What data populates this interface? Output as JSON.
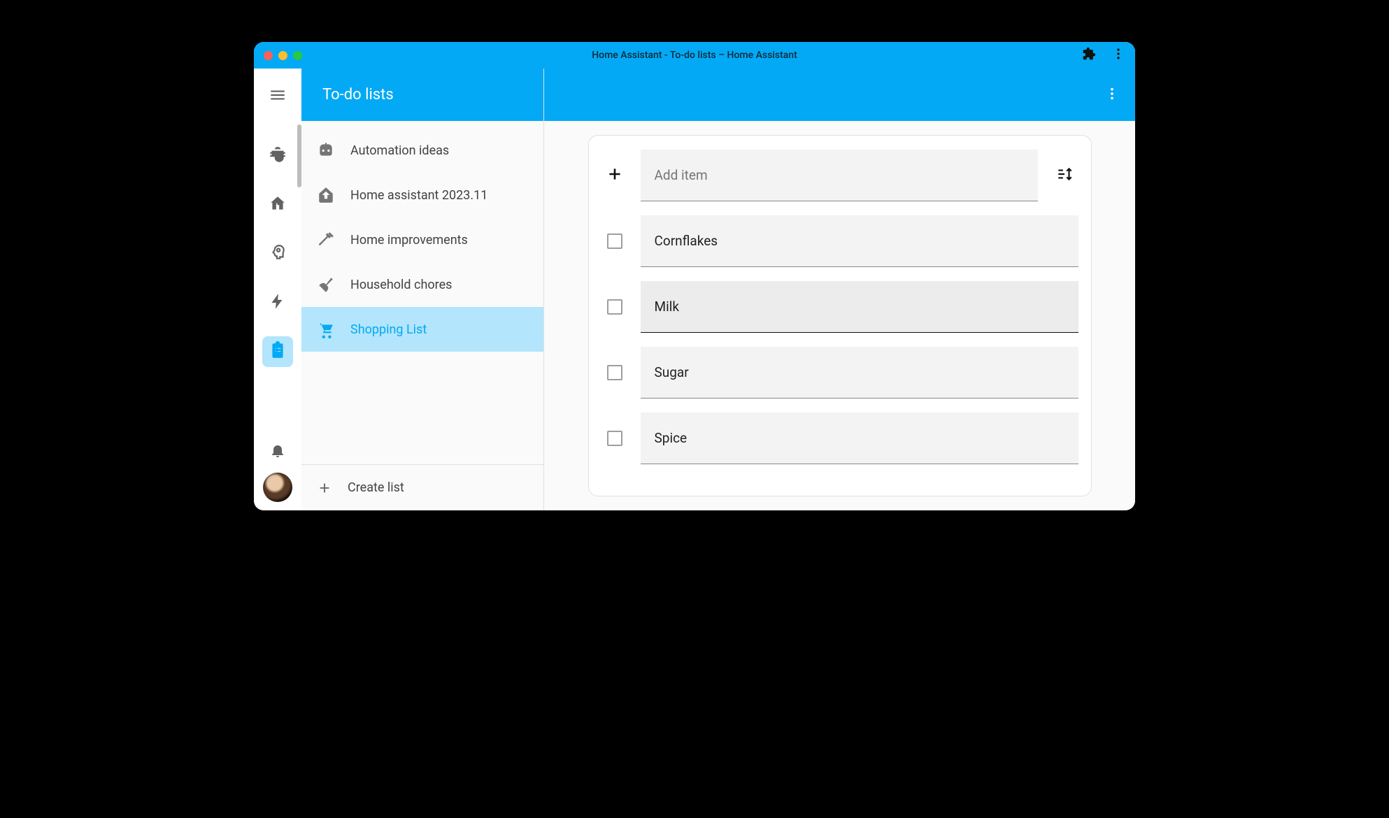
{
  "window": {
    "title": "Home Assistant - To-do lists – Home Assistant"
  },
  "sidebar": {
    "title": "To-do lists",
    "lists": [
      {
        "label": "Automation ideas"
      },
      {
        "label": "Home assistant 2023.11"
      },
      {
        "label": "Home improvements"
      },
      {
        "label": "Household chores"
      },
      {
        "label": "Shopping List"
      }
    ],
    "create_label": "Create list"
  },
  "list": {
    "add_placeholder": "Add item",
    "items": [
      {
        "label": "Cornflakes"
      },
      {
        "label": "Milk"
      },
      {
        "label": "Sugar"
      },
      {
        "label": "Spice"
      }
    ]
  }
}
